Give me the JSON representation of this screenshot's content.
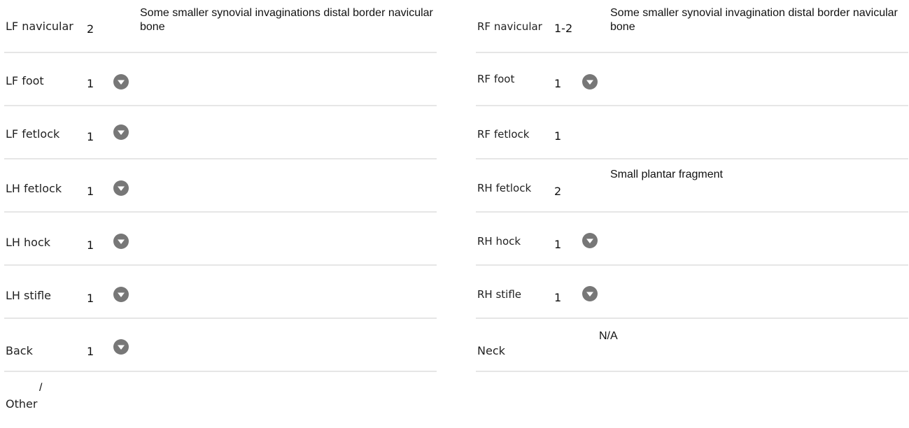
{
  "left": [
    {
      "label": "LF navicular",
      "grade": "2",
      "comment": "Some smaller synovial invaginations distal border navicular bone",
      "toggle": false
    },
    {
      "label": "LF foot",
      "grade": "1",
      "comment": "",
      "toggle": true
    },
    {
      "label": "LF fetlock",
      "grade": "1",
      "comment": "",
      "toggle": true
    },
    {
      "label": "LH fetlock",
      "grade": "1",
      "comment": "",
      "toggle": true
    },
    {
      "label": "LH hock",
      "grade": "1",
      "comment": "",
      "toggle": true
    },
    {
      "label": "LH stifle",
      "grade": "1",
      "comment": "",
      "toggle": true
    },
    {
      "label": "Back",
      "grade": "1",
      "comment": "",
      "toggle": true
    }
  ],
  "right": [
    {
      "label": "RF navicular",
      "grade": "1-2",
      "comment": "Some smaller synovial invagination distal border navicular bone",
      "toggle": false
    },
    {
      "label": "RF foot",
      "grade": "1",
      "comment": "",
      "toggle": true
    },
    {
      "label": "RF fetlock",
      "grade": "1",
      "comment": "",
      "toggle": false
    },
    {
      "label": "RH fetlock",
      "grade": "2",
      "comment": "Small plantar fragment",
      "toggle": false
    },
    {
      "label": "RH hock",
      "grade": "1",
      "comment": "",
      "toggle": true
    },
    {
      "label": "RH stifle",
      "grade": "1",
      "comment": "",
      "toggle": true
    },
    {
      "label": "Neck",
      "grade": "",
      "comment": "N/A",
      "toggle": false
    }
  ],
  "other": {
    "label": "Other",
    "value": "/"
  },
  "icons": {
    "toggle": "chevron-down-icon"
  },
  "colors": {
    "toggle_bg": "#777777",
    "divider": "#e6e6e6"
  }
}
